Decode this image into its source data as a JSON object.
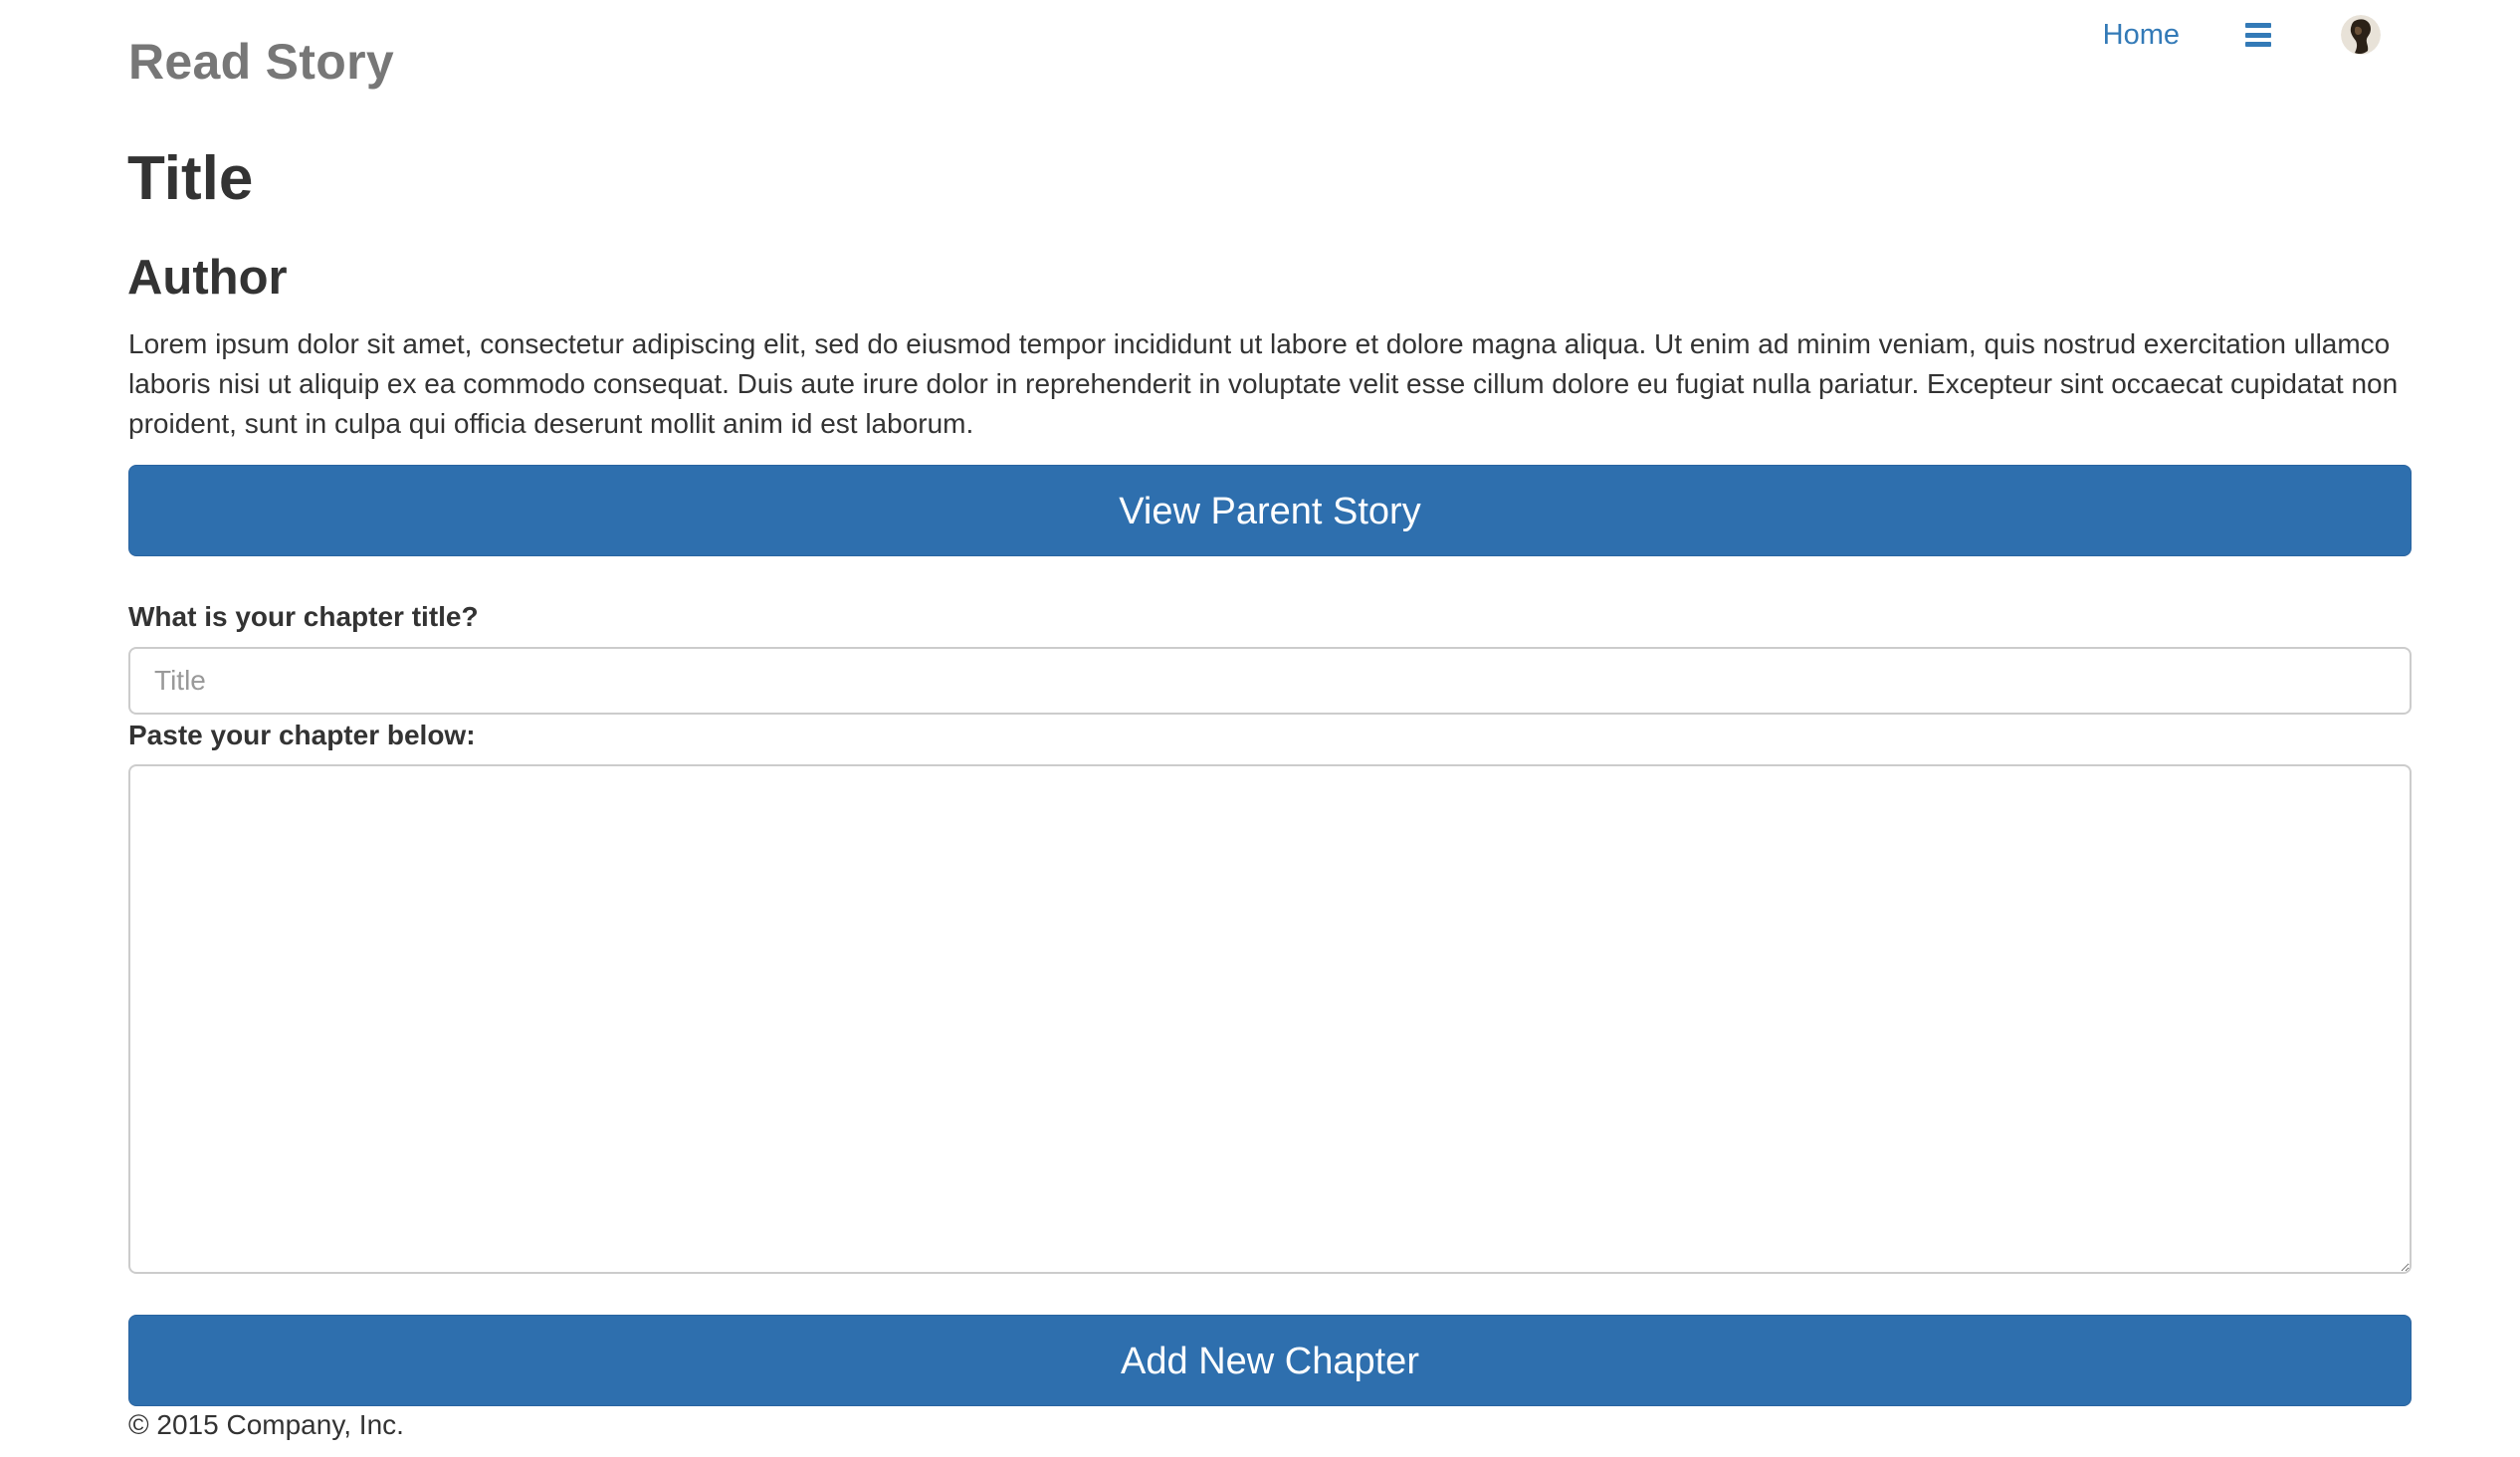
{
  "header": {
    "brand": "Read Story",
    "nav_home": "Home",
    "menu_icon": "hamburger-menu-icon",
    "avatar_icon": "user-avatar"
  },
  "story": {
    "title": "Title",
    "author": "Author",
    "summary": "Lorem ipsum dolor sit amet, consectetur adipiscing elit, sed do eiusmod tempor incididunt ut labore et dolore magna aliqua. Ut enim ad minim veniam, quis nostrud exercitation ullamco laboris nisi ut aliquip ex ea commodo consequat. Duis aute irure dolor in reprehenderit in voluptate velit esse cillum dolore eu fugiat nulla pariatur. Excepteur sint occaecat cupidatat non proident, sunt in culpa qui officia deserunt mollit anim id est laborum.",
    "view_parent_label": "View Parent Story"
  },
  "form": {
    "chapter_title_label": "What is your chapter title?",
    "chapter_title_placeholder": "Title",
    "chapter_title_value": "",
    "chapter_body_label": "Paste your chapter below:",
    "chapter_body_value": "",
    "submit_label": "Add New Chapter"
  },
  "footer": {
    "copyright": "© 2015 Company, Inc."
  },
  "colors": {
    "primary": "#2e6fae",
    "link": "#337ab7",
    "brand_text": "#777777"
  }
}
